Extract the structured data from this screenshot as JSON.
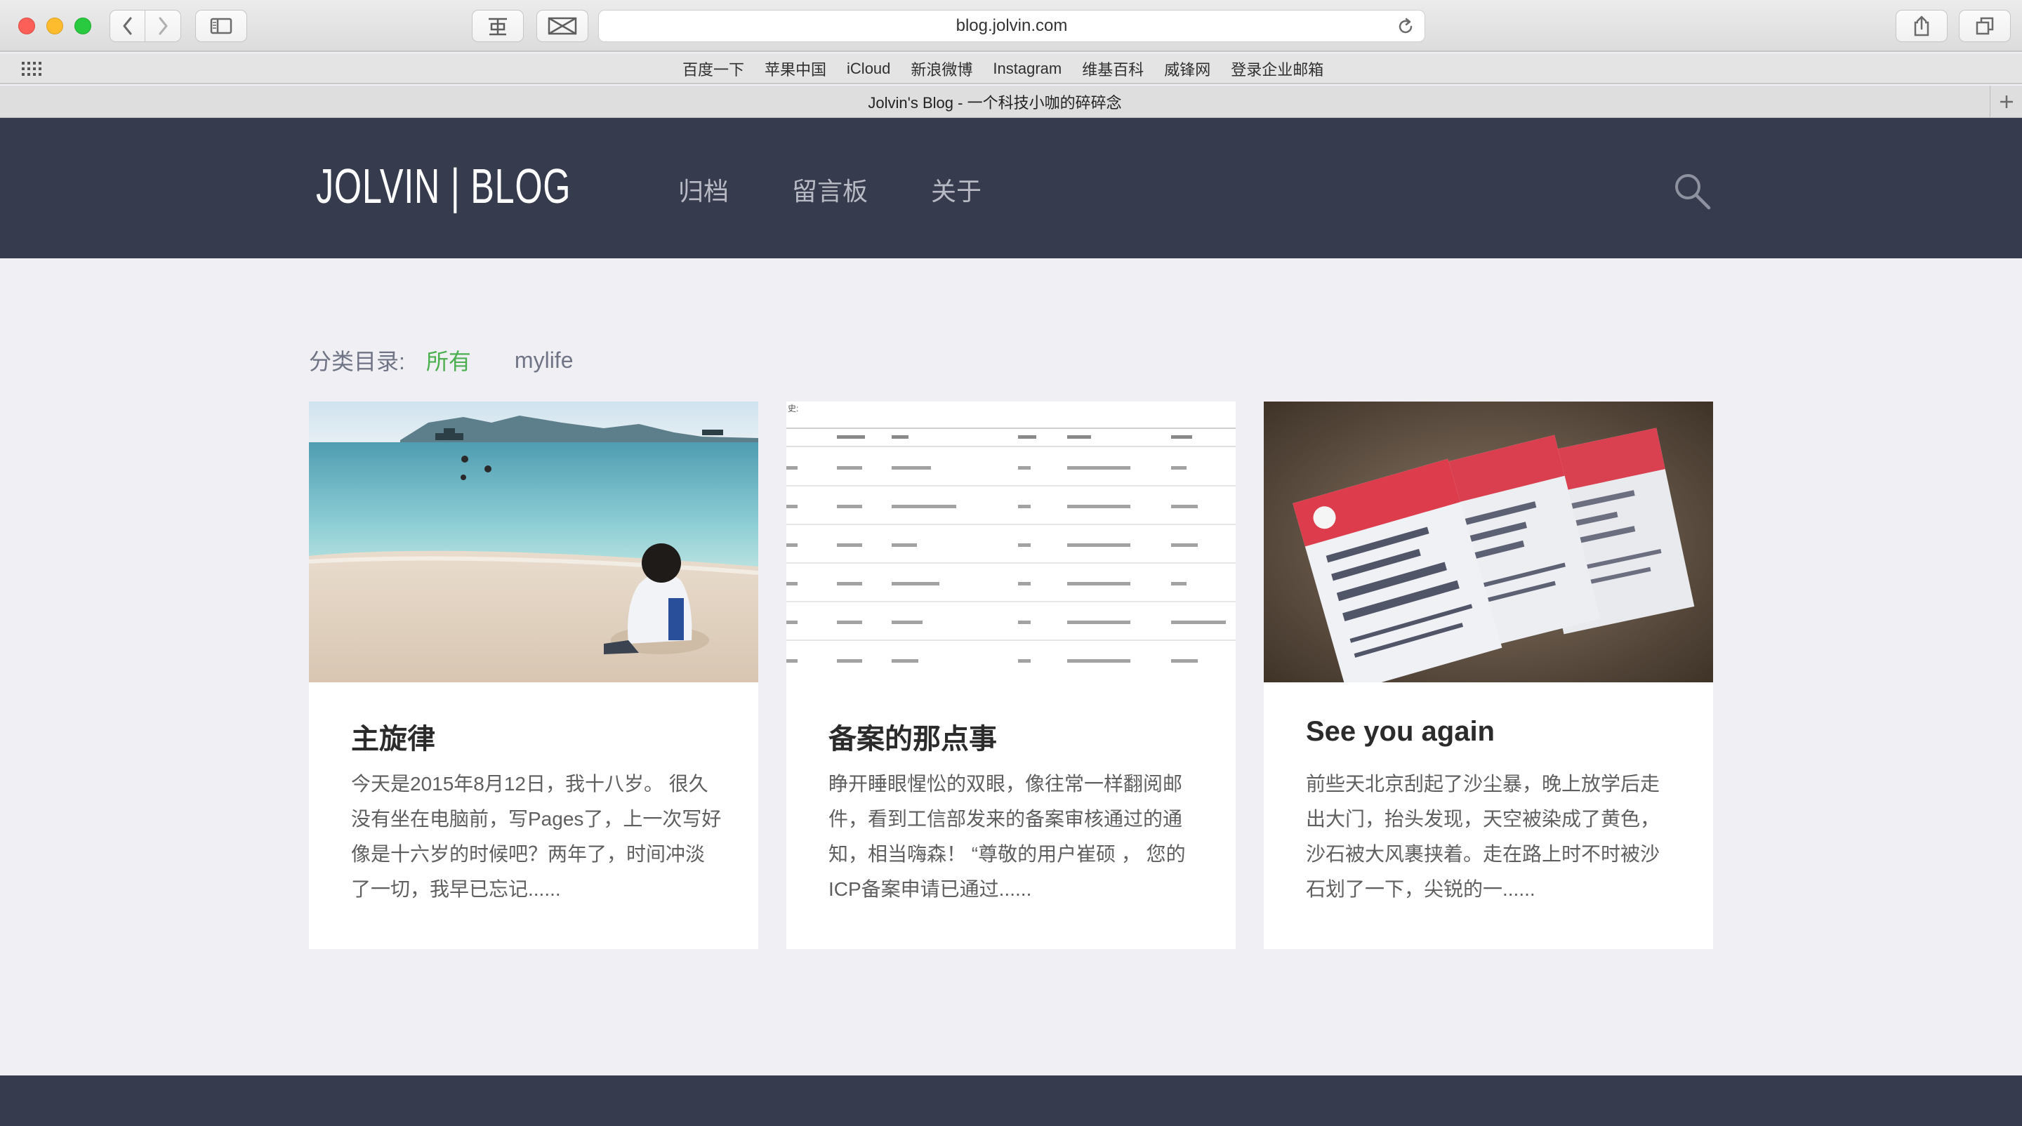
{
  "browser": {
    "url": "blog.jolvin.com",
    "tab_title": "Jolvin's Blog - 一个科技小咖的碎碎念",
    "favorites": [
      "百度一下",
      "苹果中国",
      "iCloud",
      "新浪微博",
      "Instagram",
      "维基百科",
      "威锋网",
      "登录企业邮箱"
    ],
    "icons": {
      "back": "chevron-left-icon",
      "forward": "chevron-right-icon",
      "sidebar": "sidebar-icon",
      "reader": "reader-icon",
      "extension": "bowtie-icon",
      "reload": "reload-icon",
      "share": "share-icon",
      "tabs": "tabs-icon",
      "top_sites": "grid-icon",
      "new_tab": "plus-icon"
    }
  },
  "header": {
    "logo": "JOLVIN | BLOG",
    "nav": [
      "归档",
      "留言板",
      "关于"
    ],
    "search_icon": "search-icon",
    "bg_color": "#363b4e"
  },
  "categories": {
    "label": "分类目录:",
    "items": [
      "所有",
      "mylife"
    ],
    "active_color": "#4caf50"
  },
  "posts": [
    {
      "title": "主旋律",
      "excerpt": "今天是2015年8月12日，我十八岁。 很久没有坐在电脑前，写Pages了，上一次写好像是十六岁的时候吧？两年了，时间冲淡了一切，我早已忘记......",
      "image": "beach-photo"
    },
    {
      "title": "备案的那点事",
      "excerpt": "睁开睡眼惺忪的双眼，像往常一样翻阅邮件，看到工信部发来的备案审核通过的通知，相当嗨森！ “尊敬的用户崔硕 ， 您的ICP备案申请已通过......",
      "image": "table-screenshot"
    },
    {
      "title": "See you again",
      "excerpt": "前些天北京刮起了沙尘暴，晚上放学后走出大门，抬头发现，天空被染成了黄色，沙石被大风裹挟着。走在路上时不时被沙石划了一下，尖锐的一......",
      "image": "movie-tickets-photo"
    }
  ]
}
